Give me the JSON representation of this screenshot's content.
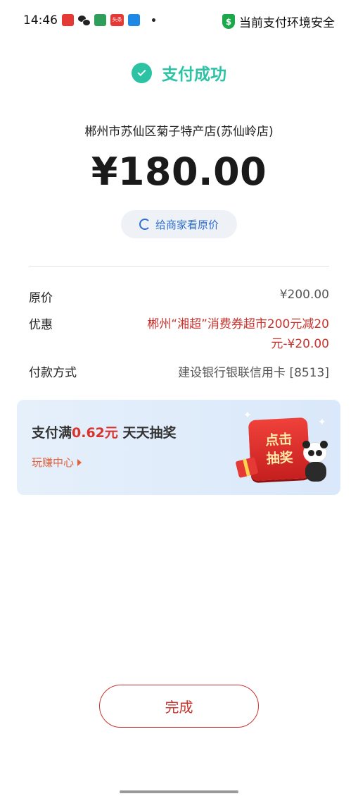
{
  "status_bar": {
    "time": "14:46",
    "app_icons": [
      "red-app-icon",
      "wechat-icon",
      "green-app-icon",
      "toutiao-icon",
      "blue-app-icon"
    ],
    "toutiao_label": "头条",
    "security_icon": "shield-dollar-icon",
    "security_text": "当前支付环境安全"
  },
  "header": {
    "status_icon": "check-circle-icon",
    "status_text": "支付成功"
  },
  "payment": {
    "merchant": "郴州市苏仙区菊子特产店(苏仙岭店)",
    "amount": "¥180.00",
    "show_price_label": "给商家看原价"
  },
  "details": [
    {
      "label": "原价",
      "value": "¥200.00"
    },
    {
      "label": "优惠",
      "value_line1": "郴州“湘超”消费券超市200元减20",
      "value_line2": "元-¥20.00"
    },
    {
      "label": "付款方式",
      "value": "建设银行银联信用卡 [8513]"
    }
  ],
  "banner": {
    "title_prefix": "支付满",
    "title_highlight": "0.62元",
    "title_suffix": " 天天抽奖",
    "link_label": "玩赚中心",
    "lottery_line1": "点击",
    "lottery_line2": "抽奖"
  },
  "done_button": "完成",
  "colors": {
    "success": "#2cc3a5",
    "accent_red": "#c9332e",
    "link_blue": "#2f6fd0",
    "banner_bg": "#e2edfa"
  }
}
